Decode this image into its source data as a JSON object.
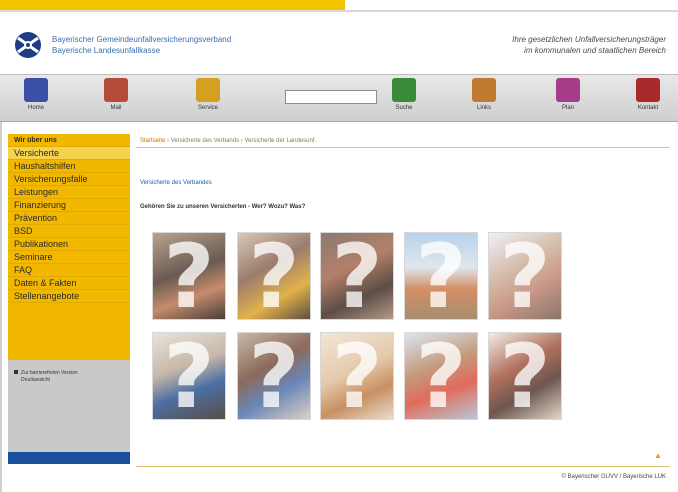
{
  "header": {
    "org_line1": "Bayerischer Gemeindeunfallversicherungsverband",
    "org_line2": "Bayerische Landesunfallkasse",
    "slogan_line1": "Ihre gesetzlichen Unfallversicherungsträger",
    "slogan_line2": "im kommunalen und staatlichen Bereich"
  },
  "toolbar": {
    "items": [
      {
        "label": "Home",
        "icon": "home-icon",
        "color": "#3b4fa8"
      },
      {
        "label": "Mail",
        "icon": "mail-icon",
        "color": "#b44a3a"
      },
      {
        "label": "Service",
        "icon": "service-icon",
        "color": "#d4a020"
      }
    ],
    "items_right": [
      {
        "label": "Suche",
        "icon": "search-icon",
        "color": "#3a8a3a"
      },
      {
        "label": "Links",
        "icon": "links-icon",
        "color": "#c07a30"
      },
      {
        "label": "Plan",
        "icon": "plan-icon",
        "color": "#a83a8a"
      },
      {
        "label": "Kontakt",
        "icon": "phone-icon",
        "color": "#a82a2a"
      }
    ],
    "search_value": ""
  },
  "sidebar": {
    "items": [
      {
        "label": "Wir über uns",
        "active": false
      },
      {
        "label": "Versicherte",
        "active": true
      },
      {
        "label": "Haushaltshilfen",
        "active": false
      },
      {
        "label": "Versicherungsfalle",
        "active": false
      },
      {
        "label": "Leistungen",
        "active": false
      },
      {
        "label": "Finanzierung",
        "active": false
      },
      {
        "label": "Prävention",
        "active": false
      },
      {
        "label": "BSD",
        "active": false
      },
      {
        "label": "Publikationen",
        "active": false
      },
      {
        "label": "Seminare",
        "active": false
      },
      {
        "label": "FAQ",
        "active": false
      },
      {
        "label": "Daten & Fakten",
        "active": false
      },
      {
        "label": "Stellenangebote",
        "active": false
      }
    ],
    "note_line1": "Zur barrierefreien Version",
    "note_line2": "Druckansicht"
  },
  "main": {
    "breadcrumb": [
      "Startseite",
      "Versicherte des Verbands",
      "Versicherte der Landesunf."
    ],
    "section_title": "Versicherte des Verbandes",
    "question": "Gehören Sie zu unseren Versicherten - Wer? Wozu? Was?",
    "copyright": "© Bayerischer GUVV / Bayerische LUK"
  },
  "colors": {
    "accent": "#f2b800",
    "nav_blue": "#1a4f9e",
    "link_blue": "#1f5ea8"
  }
}
